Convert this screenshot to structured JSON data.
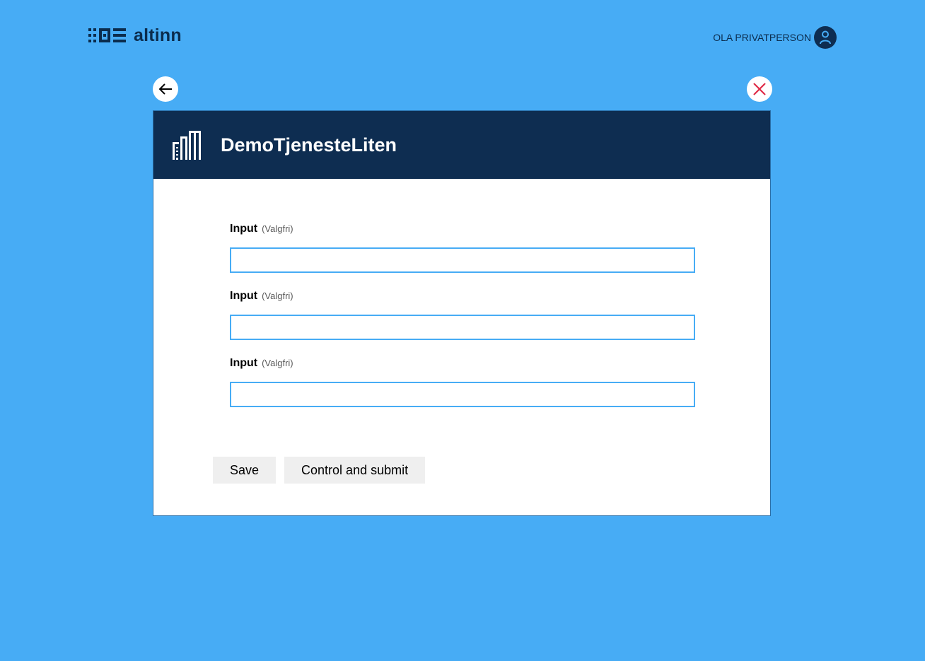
{
  "header": {
    "logo_text": "altinn",
    "user_name": "OLA PRIVATPERSON"
  },
  "navigation": {
    "back_icon": "arrow-left-icon",
    "close_icon": "close-icon"
  },
  "card": {
    "title": "DemoTjenesteLiten",
    "header_icon": "building-icon"
  },
  "form": {
    "fields": [
      {
        "label": "Input",
        "optional_label": "(Valgfri)",
        "value": ""
      },
      {
        "label": "Input",
        "optional_label": "(Valgfri)",
        "value": ""
      },
      {
        "label": "Input",
        "optional_label": "(Valgfri)",
        "value": ""
      }
    ]
  },
  "actions": {
    "save_label": "Save",
    "submit_label": "Control and submit"
  },
  "colors": {
    "background": "#47acf5",
    "header_dark": "#0e2d51",
    "close_red": "#e02e49",
    "button_grey": "#efefef"
  }
}
